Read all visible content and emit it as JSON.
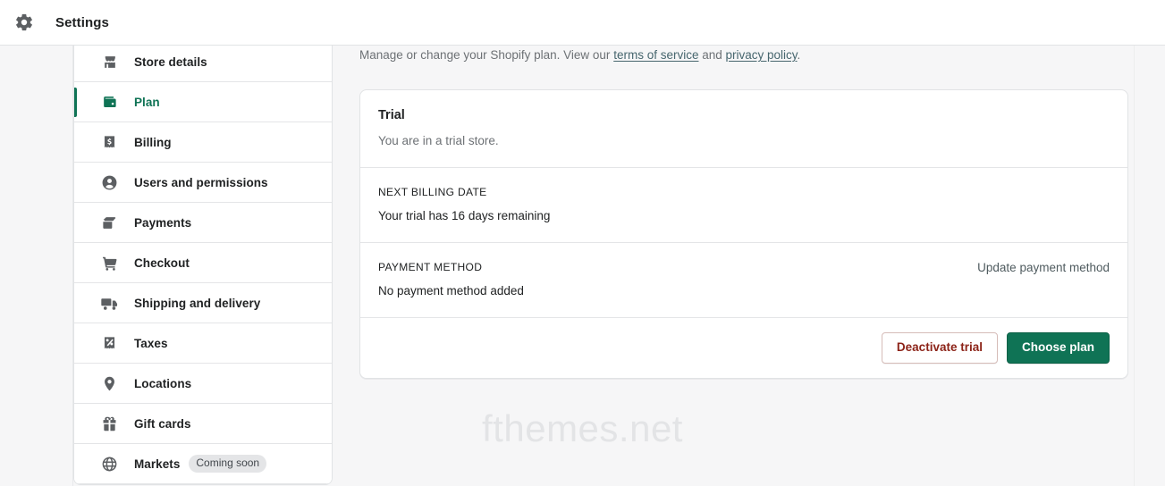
{
  "header": {
    "icon": "gear-icon",
    "title": "Settings"
  },
  "sidebar": {
    "items": [
      {
        "icon": "store-icon",
        "label": "Store details",
        "active": false,
        "badge": null
      },
      {
        "icon": "wallet-icon",
        "label": "Plan",
        "active": true,
        "badge": null
      },
      {
        "icon": "receipt-icon",
        "label": "Billing",
        "active": false,
        "badge": null
      },
      {
        "icon": "person-icon",
        "label": "Users and permissions",
        "active": false,
        "badge": null
      },
      {
        "icon": "card-icon",
        "label": "Payments",
        "active": false,
        "badge": null
      },
      {
        "icon": "cart-icon",
        "label": "Checkout",
        "active": false,
        "badge": null
      },
      {
        "icon": "truck-icon",
        "label": "Shipping and delivery",
        "active": false,
        "badge": null
      },
      {
        "icon": "percent-icon",
        "label": "Taxes",
        "active": false,
        "badge": null
      },
      {
        "icon": "pin-icon",
        "label": "Locations",
        "active": false,
        "badge": null
      },
      {
        "icon": "gift-icon",
        "label": "Gift cards",
        "active": false,
        "badge": null
      },
      {
        "icon": "globe-icon",
        "label": "Markets",
        "active": false,
        "badge": "Coming soon"
      }
    ]
  },
  "main": {
    "intro": {
      "text_before": "Manage or change your Shopify plan. View our ",
      "link_terms": "terms of service",
      "text_middle": " and ",
      "link_privacy": "privacy policy",
      "text_after": "."
    },
    "plan_card": {
      "trial": {
        "title": "Trial",
        "subtitle": "You are in a trial store."
      },
      "next_billing": {
        "label": "NEXT BILLING DATE",
        "value": "Your trial has 16 days remaining"
      },
      "payment_method": {
        "label": "PAYMENT METHOD",
        "value": "No payment method added",
        "action": "Update payment method"
      },
      "buttons": {
        "deactivate": "Deactivate trial",
        "choose": "Choose plan"
      }
    }
  },
  "watermark": "fthemes.net",
  "colors": {
    "accent_green": "#0f7355",
    "danger_red": "#8c2318",
    "page_background": "#f6f6f7",
    "border": "#e1e3e5"
  }
}
